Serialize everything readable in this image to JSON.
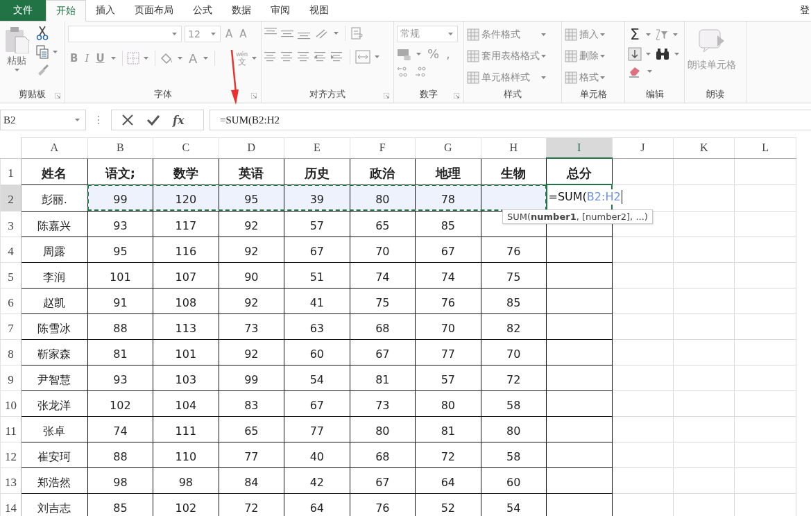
{
  "tabs": [
    {
      "label": "文件",
      "kind": "file",
      "selected": false
    },
    {
      "label": "开始",
      "kind": "tab",
      "selected": true
    },
    {
      "label": "插入",
      "kind": "tab",
      "selected": false
    },
    {
      "label": "页面布局",
      "kind": "tab",
      "selected": false
    },
    {
      "label": "公式",
      "kind": "tab",
      "selected": false
    },
    {
      "label": "数据",
      "kind": "tab",
      "selected": false
    },
    {
      "label": "审阅",
      "kind": "tab",
      "selected": false
    },
    {
      "label": "视图",
      "kind": "tab",
      "selected": false
    }
  ],
  "account": "登",
  "ribbon": {
    "groups": [
      {
        "kind": "clipboard",
        "label": "剪贴板",
        "paste": "粘贴"
      },
      {
        "kind": "font",
        "label": "字体",
        "size": "12",
        "grow": "A",
        "shrink": "A",
        "bold": "B",
        "italic": "I",
        "underline": "U",
        "font_color": "A",
        "phonetic": "wén",
        "phonetic_char": "文"
      },
      {
        "kind": "alignment",
        "label": "对齐方式"
      },
      {
        "kind": "number",
        "label": "数字",
        "format": "常规",
        "percent": "%",
        "comma": ","
      },
      {
        "kind": "list",
        "label": "样式",
        "items": [
          "条件格式",
          "套用表格格式",
          "单元格样式"
        ]
      },
      {
        "kind": "list",
        "label": "单元格",
        "items": [
          "插入",
          "删除",
          "格式"
        ]
      },
      {
        "kind": "editing",
        "label": "编辑",
        "sum": "Σ"
      },
      {
        "kind": "big",
        "label": "朗读",
        "button": "朗读单元格"
      }
    ]
  },
  "formula_bar": {
    "name_box": "B2",
    "function_button": "fx",
    "formula": "=SUM(B2:H2"
  },
  "sheet": {
    "columns": [
      {
        "label": "A",
        "selected": false,
        "bordered": true
      },
      {
        "label": "B",
        "selected": false,
        "bordered": true
      },
      {
        "label": "C",
        "selected": false,
        "bordered": true
      },
      {
        "label": "D",
        "selected": false,
        "bordered": true
      },
      {
        "label": "E",
        "selected": false,
        "bordered": true
      },
      {
        "label": "F",
        "selected": false,
        "bordered": true
      },
      {
        "label": "G",
        "selected": false,
        "bordered": true
      },
      {
        "label": "H",
        "selected": false,
        "bordered": true
      },
      {
        "label": "I",
        "selected": true,
        "bordered": true
      },
      {
        "label": "J",
        "selected": false,
        "bordered": false
      },
      {
        "label": "K",
        "selected": false,
        "bordered": false
      },
      {
        "label": "L",
        "selected": false,
        "bordered": false
      }
    ],
    "rows": [
      {
        "number": "1",
        "kind": "header",
        "selected": false,
        "cells": [
          "姓名",
          "语文;",
          "数学",
          "英语",
          "历史",
          "政治",
          "地理",
          "生物",
          "总分"
        ]
      },
      {
        "number": "2",
        "kind": "data",
        "selected": true,
        "cells": [
          "彭丽.",
          {
            "text": "99",
            "in_range": true
          },
          {
            "text": "120",
            "in_range": true
          },
          {
            "text": "95",
            "in_range": true
          },
          {
            "text": "39",
            "in_range": true
          },
          {
            "text": "80",
            "in_range": true
          },
          {
            "text": "78",
            "in_range": true
          },
          {
            "in_range": true
          },
          {
            "kind": "editing",
            "text": "=SUM(",
            "ref": "B2:H2"
          }
        ]
      },
      {
        "number": "3",
        "kind": "data",
        "selected": false,
        "cells": [
          "陈嘉兴",
          "93",
          "117",
          "92",
          "57",
          "65",
          "85"
        ]
      },
      {
        "number": "4",
        "kind": "data",
        "selected": false,
        "cells": [
          "周露",
          "95",
          "116",
          "92",
          "67",
          "70",
          "67",
          "76"
        ]
      },
      {
        "number": "5",
        "kind": "data",
        "selected": false,
        "cells": [
          "李润",
          "101",
          "107",
          "90",
          "51",
          "74",
          "74",
          "75"
        ]
      },
      {
        "number": "6",
        "kind": "data",
        "selected": false,
        "cells": [
          "赵凯",
          "91",
          "108",
          "92",
          "41",
          "75",
          "76",
          "85"
        ]
      },
      {
        "number": "7",
        "kind": "data",
        "selected": false,
        "cells": [
          "陈雪冰",
          "88",
          "113",
          "73",
          "63",
          "68",
          "70",
          "82"
        ]
      },
      {
        "number": "8",
        "kind": "data",
        "selected": false,
        "cells": [
          "靳家森",
          "81",
          "101",
          "92",
          "60",
          "67",
          "77",
          "70"
        ]
      },
      {
        "number": "9",
        "kind": "data",
        "selected": false,
        "cells": [
          "尹智慧",
          "93",
          "103",
          "99",
          "54",
          "81",
          "57",
          "72"
        ]
      },
      {
        "number": "10",
        "kind": "data",
        "selected": false,
        "cells": [
          "张龙洋",
          "102",
          "104",
          "83",
          "67",
          "73",
          "80",
          "58"
        ]
      },
      {
        "number": "11",
        "kind": "data",
        "selected": false,
        "cells": [
          "张卓",
          "74",
          "111",
          "65",
          "77",
          "80",
          "81",
          "80"
        ]
      },
      {
        "number": "12",
        "kind": "data",
        "selected": false,
        "cells": [
          "崔安珂",
          "88",
          "110",
          "77",
          "40",
          "68",
          "72",
          "58"
        ]
      },
      {
        "number": "13",
        "kind": "data",
        "selected": false,
        "cells": [
          "郑浩然",
          "98",
          "98",
          "84",
          "42",
          "67",
          "64",
          "60"
        ]
      },
      {
        "number": "14",
        "kind": "data",
        "selected": false,
        "cells": [
          "刘吉志",
          "85",
          "102",
          "72",
          "64",
          "76",
          "52",
          "54"
        ]
      }
    ],
    "tooltip": "SUM(**number1**, [number2], ...)"
  }
}
